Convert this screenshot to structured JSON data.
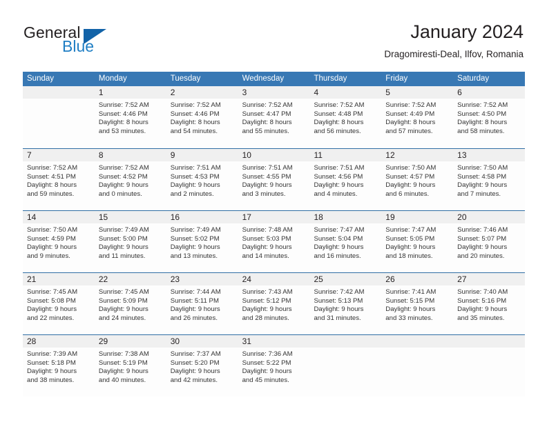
{
  "brand": {
    "name_part1": "General",
    "name_part2": "Blue",
    "flag_icon": "blue-triangle-flag-icon",
    "accent_color": "#1263a8",
    "blue_text_color": "#1f7ec4"
  },
  "header": {
    "title": "January 2024",
    "subtitle": "Dragomiresti-Deal, Ilfov, Romania"
  },
  "calendar": {
    "header_bg_color": "#3878b4",
    "day_band_color": "#f0f0f0",
    "row_divider_color": "#2e6da4",
    "weekdays": [
      "Sunday",
      "Monday",
      "Tuesday",
      "Wednesday",
      "Thursday",
      "Friday",
      "Saturday"
    ],
    "weeks": [
      [
        {
          "day": "",
          "lines": []
        },
        {
          "day": "1",
          "lines": [
            "Sunrise: 7:52 AM",
            "Sunset: 4:46 PM",
            "Daylight: 8 hours",
            "and 53 minutes."
          ]
        },
        {
          "day": "2",
          "lines": [
            "Sunrise: 7:52 AM",
            "Sunset: 4:46 PM",
            "Daylight: 8 hours",
            "and 54 minutes."
          ]
        },
        {
          "day": "3",
          "lines": [
            "Sunrise: 7:52 AM",
            "Sunset: 4:47 PM",
            "Daylight: 8 hours",
            "and 55 minutes."
          ]
        },
        {
          "day": "4",
          "lines": [
            "Sunrise: 7:52 AM",
            "Sunset: 4:48 PM",
            "Daylight: 8 hours",
            "and 56 minutes."
          ]
        },
        {
          "day": "5",
          "lines": [
            "Sunrise: 7:52 AM",
            "Sunset: 4:49 PM",
            "Daylight: 8 hours",
            "and 57 minutes."
          ]
        },
        {
          "day": "6",
          "lines": [
            "Sunrise: 7:52 AM",
            "Sunset: 4:50 PM",
            "Daylight: 8 hours",
            "and 58 minutes."
          ]
        }
      ],
      [
        {
          "day": "7",
          "lines": [
            "Sunrise: 7:52 AM",
            "Sunset: 4:51 PM",
            "Daylight: 8 hours",
            "and 59 minutes."
          ]
        },
        {
          "day": "8",
          "lines": [
            "Sunrise: 7:52 AM",
            "Sunset: 4:52 PM",
            "Daylight: 9 hours",
            "and 0 minutes."
          ]
        },
        {
          "day": "9",
          "lines": [
            "Sunrise: 7:51 AM",
            "Sunset: 4:53 PM",
            "Daylight: 9 hours",
            "and 2 minutes."
          ]
        },
        {
          "day": "10",
          "lines": [
            "Sunrise: 7:51 AM",
            "Sunset: 4:55 PM",
            "Daylight: 9 hours",
            "and 3 minutes."
          ]
        },
        {
          "day": "11",
          "lines": [
            "Sunrise: 7:51 AM",
            "Sunset: 4:56 PM",
            "Daylight: 9 hours",
            "and 4 minutes."
          ]
        },
        {
          "day": "12",
          "lines": [
            "Sunrise: 7:50 AM",
            "Sunset: 4:57 PM",
            "Daylight: 9 hours",
            "and 6 minutes."
          ]
        },
        {
          "day": "13",
          "lines": [
            "Sunrise: 7:50 AM",
            "Sunset: 4:58 PM",
            "Daylight: 9 hours",
            "and 7 minutes."
          ]
        }
      ],
      [
        {
          "day": "14",
          "lines": [
            "Sunrise: 7:50 AM",
            "Sunset: 4:59 PM",
            "Daylight: 9 hours",
            "and 9 minutes."
          ]
        },
        {
          "day": "15",
          "lines": [
            "Sunrise: 7:49 AM",
            "Sunset: 5:00 PM",
            "Daylight: 9 hours",
            "and 11 minutes."
          ]
        },
        {
          "day": "16",
          "lines": [
            "Sunrise: 7:49 AM",
            "Sunset: 5:02 PM",
            "Daylight: 9 hours",
            "and 13 minutes."
          ]
        },
        {
          "day": "17",
          "lines": [
            "Sunrise: 7:48 AM",
            "Sunset: 5:03 PM",
            "Daylight: 9 hours",
            "and 14 minutes."
          ]
        },
        {
          "day": "18",
          "lines": [
            "Sunrise: 7:47 AM",
            "Sunset: 5:04 PM",
            "Daylight: 9 hours",
            "and 16 minutes."
          ]
        },
        {
          "day": "19",
          "lines": [
            "Sunrise: 7:47 AM",
            "Sunset: 5:05 PM",
            "Daylight: 9 hours",
            "and 18 minutes."
          ]
        },
        {
          "day": "20",
          "lines": [
            "Sunrise: 7:46 AM",
            "Sunset: 5:07 PM",
            "Daylight: 9 hours",
            "and 20 minutes."
          ]
        }
      ],
      [
        {
          "day": "21",
          "lines": [
            "Sunrise: 7:45 AM",
            "Sunset: 5:08 PM",
            "Daylight: 9 hours",
            "and 22 minutes."
          ]
        },
        {
          "day": "22",
          "lines": [
            "Sunrise: 7:45 AM",
            "Sunset: 5:09 PM",
            "Daylight: 9 hours",
            "and 24 minutes."
          ]
        },
        {
          "day": "23",
          "lines": [
            "Sunrise: 7:44 AM",
            "Sunset: 5:11 PM",
            "Daylight: 9 hours",
            "and 26 minutes."
          ]
        },
        {
          "day": "24",
          "lines": [
            "Sunrise: 7:43 AM",
            "Sunset: 5:12 PM",
            "Daylight: 9 hours",
            "and 28 minutes."
          ]
        },
        {
          "day": "25",
          "lines": [
            "Sunrise: 7:42 AM",
            "Sunset: 5:13 PM",
            "Daylight: 9 hours",
            "and 31 minutes."
          ]
        },
        {
          "day": "26",
          "lines": [
            "Sunrise: 7:41 AM",
            "Sunset: 5:15 PM",
            "Daylight: 9 hours",
            "and 33 minutes."
          ]
        },
        {
          "day": "27",
          "lines": [
            "Sunrise: 7:40 AM",
            "Sunset: 5:16 PM",
            "Daylight: 9 hours",
            "and 35 minutes."
          ]
        }
      ],
      [
        {
          "day": "28",
          "lines": [
            "Sunrise: 7:39 AM",
            "Sunset: 5:18 PM",
            "Daylight: 9 hours",
            "and 38 minutes."
          ]
        },
        {
          "day": "29",
          "lines": [
            "Sunrise: 7:38 AM",
            "Sunset: 5:19 PM",
            "Daylight: 9 hours",
            "and 40 minutes."
          ]
        },
        {
          "day": "30",
          "lines": [
            "Sunrise: 7:37 AM",
            "Sunset: 5:20 PM",
            "Daylight: 9 hours",
            "and 42 minutes."
          ]
        },
        {
          "day": "31",
          "lines": [
            "Sunrise: 7:36 AM",
            "Sunset: 5:22 PM",
            "Daylight: 9 hours",
            "and 45 minutes."
          ]
        },
        {
          "day": "",
          "lines": []
        },
        {
          "day": "",
          "lines": []
        },
        {
          "day": "",
          "lines": []
        }
      ]
    ]
  }
}
